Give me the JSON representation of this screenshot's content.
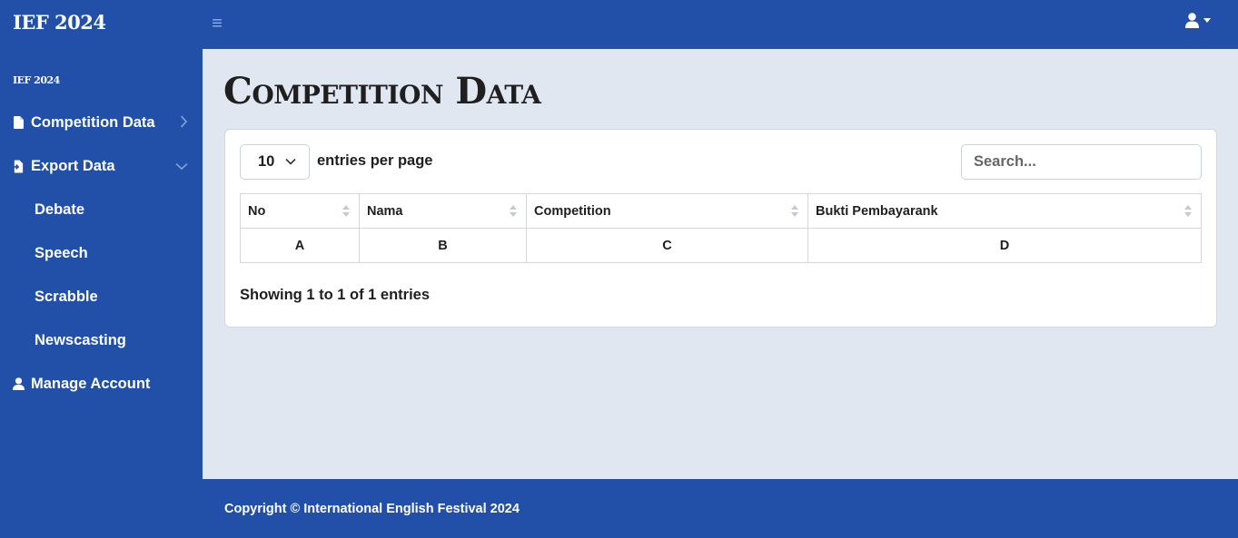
{
  "app": {
    "brand": "IEF 2024"
  },
  "sidebar": {
    "heading": "IEF 2024",
    "items": [
      {
        "label": "Competition Data",
        "icon": "file-icon"
      },
      {
        "label": "Export Data",
        "icon": "file-export-icon"
      }
    ],
    "sub_items": [
      "Debate",
      "Speech",
      "Scrabble",
      "Newscasting"
    ],
    "account": {
      "label": "Manage Account",
      "icon": "user-icon"
    }
  },
  "main": {
    "title": "Competition Data",
    "per_page": {
      "value": "10",
      "label": "entries per page"
    },
    "search": {
      "placeholder": "Search..."
    },
    "table": {
      "columns": [
        "No",
        "Nama",
        "Competition",
        "Bukti Pembayarank"
      ],
      "rows": [
        [
          "A",
          "B",
          "C",
          "D"
        ]
      ]
    },
    "info": "Showing 1 to 1 of 1 entries"
  },
  "footer": {
    "text": "Copyright © International English Festival 2024"
  },
  "colors": {
    "primary": "#224fa8",
    "background": "#e1e7f0"
  }
}
